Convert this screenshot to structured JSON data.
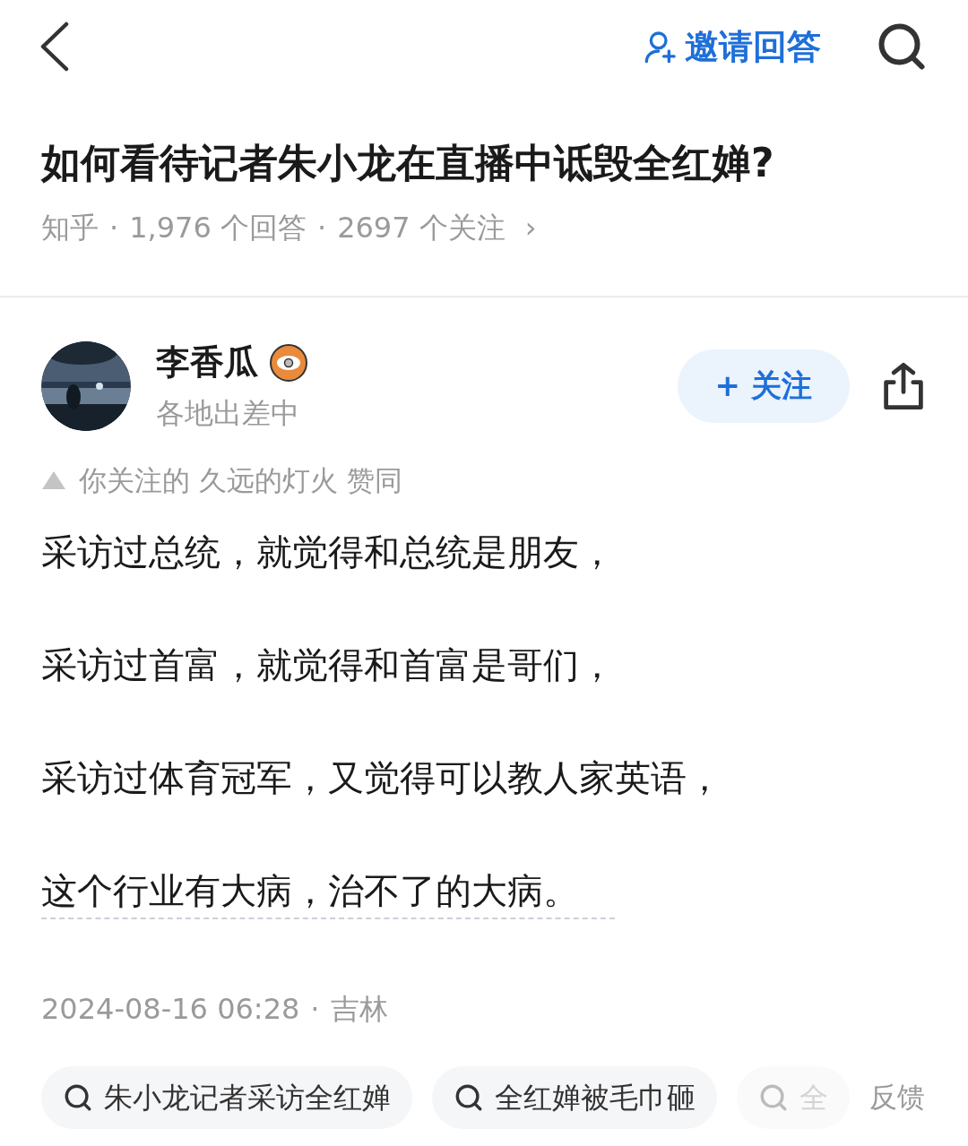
{
  "header": {
    "invite_label": "邀请回答"
  },
  "question": {
    "title": "如何看待记者朱小龙在直播中诋毁全红婵?",
    "source": "知乎",
    "answers": "1,976 个回答",
    "followers": "2697 个关注",
    "separator": "·",
    "chevron": "›"
  },
  "author": {
    "name": "李香瓜",
    "bio": "各地出差中",
    "follow_label": "关注",
    "follow_sign": "+",
    "followed": false
  },
  "endorsement": "你关注的 久远的灯火 赞同",
  "paragraphs": [
    "采访过总统，就觉得和总统是朋友，",
    "采访过首富，就觉得和首富是哥们，",
    "采访过体育冠军，又觉得可以教人家英语，",
    "这个行业有大病，治不了的大病。"
  ],
  "meta": {
    "time": "2024-08-16 06:28",
    "separator": "·",
    "location": "吉林"
  },
  "related_searches": [
    {
      "text": "朱小龙记者采访全红婵",
      "faded": false
    },
    {
      "text": "全红婵被毛巾砸",
      "faded": false
    },
    {
      "text": "全",
      "faded": true
    }
  ],
  "feedback_label": "反馈"
}
